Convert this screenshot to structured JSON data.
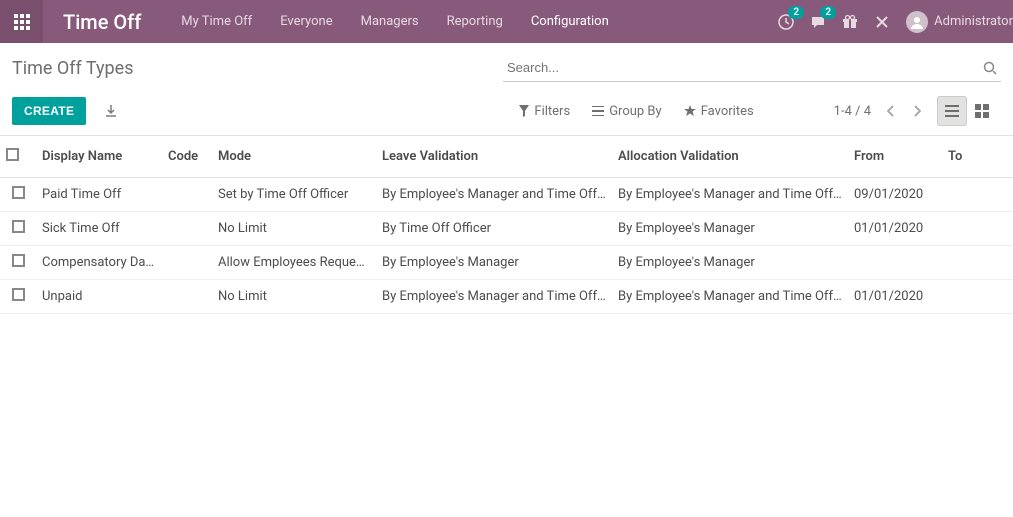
{
  "topbar": {
    "brand": "Time Off",
    "nav": [
      "My Time Off",
      "Everyone",
      "Managers",
      "Reporting",
      "Configuration"
    ],
    "activeNav": 4,
    "clockBadge": "2",
    "chatBadge": "2",
    "user": "Administrator"
  },
  "cp": {
    "breadcrumb": "Time Off Types",
    "searchPlaceholder": "Search...",
    "createLabel": "CREATE",
    "filtersLabel": "Filters",
    "groupByLabel": "Group By",
    "favoritesLabel": "Favorites",
    "pager": "1-4 / 4"
  },
  "colors": {
    "primary": "#875a7b",
    "accent": "#00a09d"
  },
  "table": {
    "headers": {
      "name": "Display Name",
      "code": "Code",
      "mode": "Mode",
      "leave": "Leave Validation",
      "alloc": "Allocation Validation",
      "from": "From",
      "to": "To"
    },
    "rows": [
      {
        "name": "Paid Time Off",
        "code": "",
        "mode": "Set by Time Off Officer",
        "leave": "By Employee's Manager and Time Off Officer",
        "alloc": "By Employee's Manager and Time Off Officer",
        "from": "09/01/2020",
        "to": ""
      },
      {
        "name": "Sick Time Off",
        "code": "",
        "mode": "No Limit",
        "leave": "By Time Off Officer",
        "alloc": "By Employee's Manager",
        "from": "01/01/2020",
        "to": ""
      },
      {
        "name": "Compensatory Days",
        "code": "",
        "mode": "Allow Employees Requests",
        "leave": "By Employee's Manager",
        "alloc": "By Employee's Manager",
        "from": "",
        "to": ""
      },
      {
        "name": "Unpaid",
        "code": "",
        "mode": "No Limit",
        "leave": "By Employee's Manager and Time Off Officer",
        "alloc": "By Employee's Manager and Time Off Officer",
        "from": "01/01/2020",
        "to": ""
      }
    ]
  }
}
